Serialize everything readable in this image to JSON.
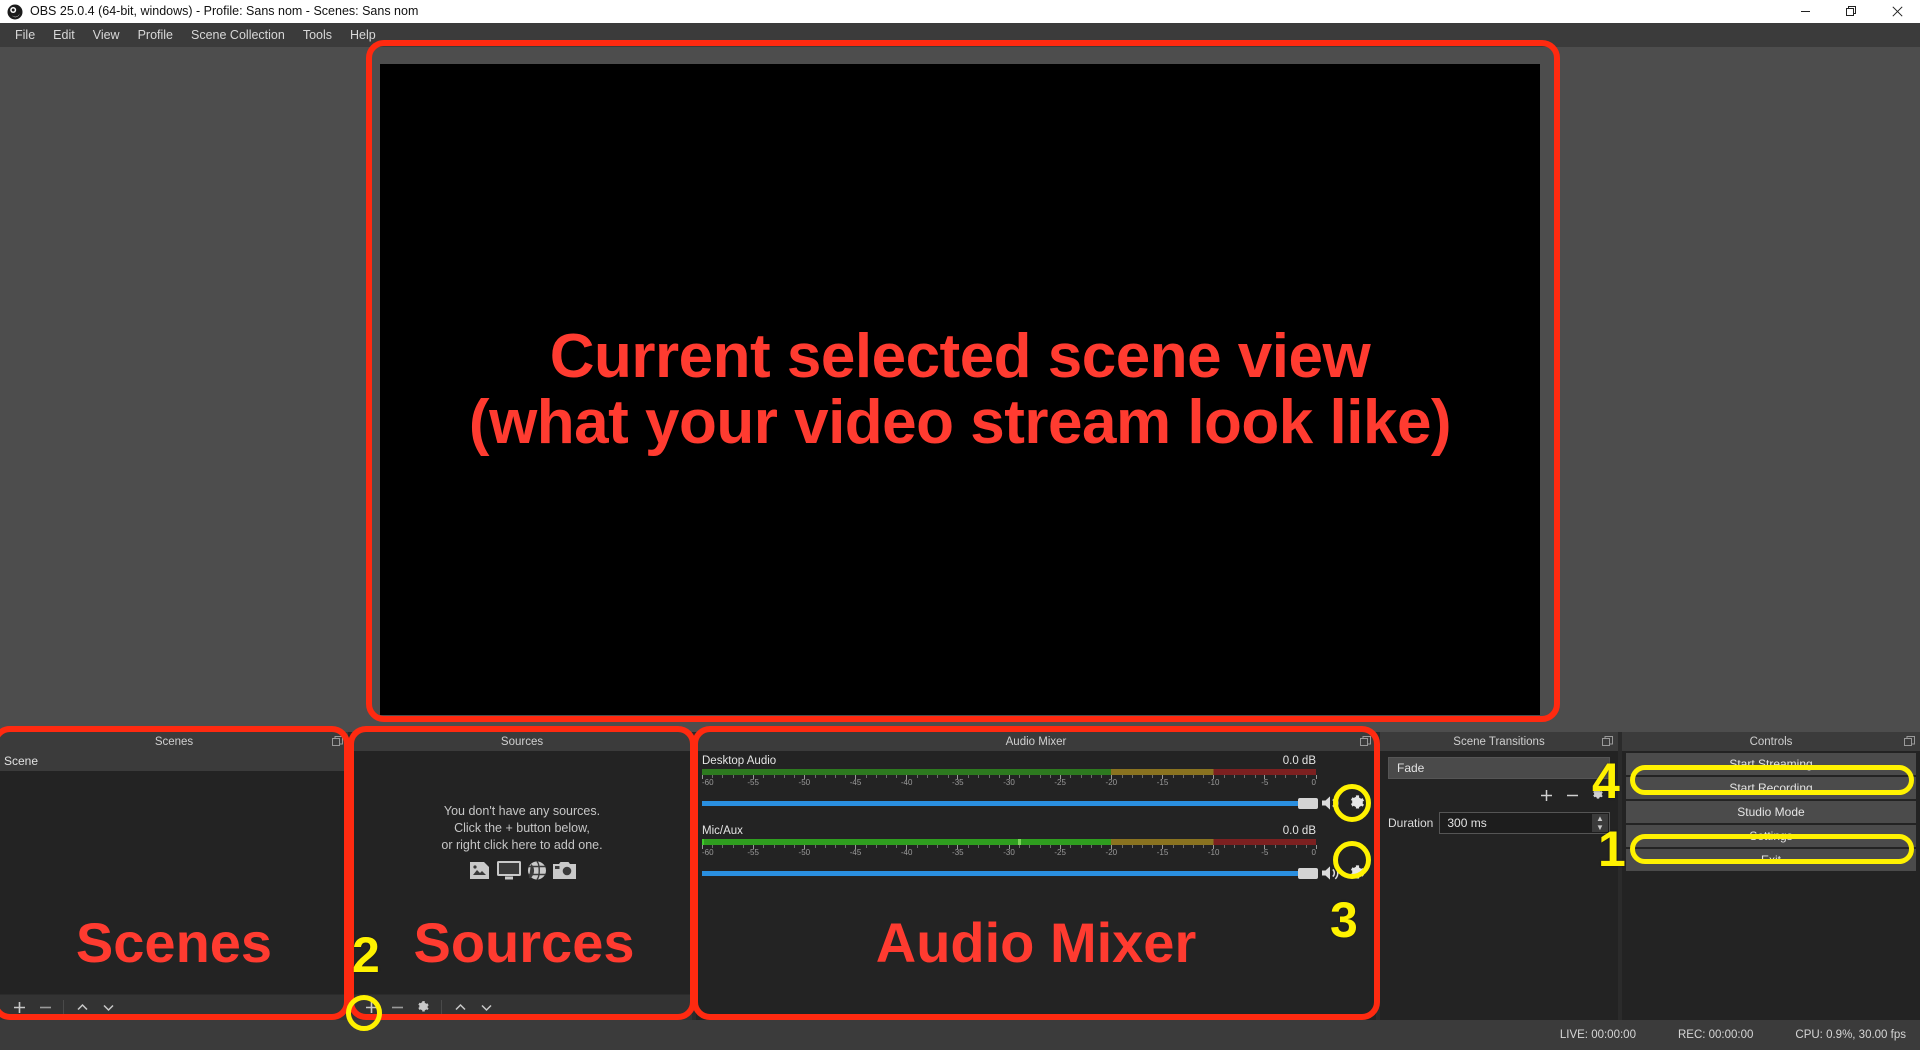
{
  "window": {
    "title": "OBS 25.0.4 (64-bit, windows) - Profile: Sans nom - Scenes: Sans nom",
    "app_icon": "obs-logo-icon",
    "minimize_label": "–",
    "maximize_label": "❐",
    "close_label": "✕"
  },
  "menubar": {
    "items": [
      {
        "label": "File"
      },
      {
        "label": "Edit"
      },
      {
        "label": "View"
      },
      {
        "label": "Profile"
      },
      {
        "label": "Scene Collection"
      },
      {
        "label": "Tools"
      },
      {
        "label": "Help"
      }
    ]
  },
  "preview": {
    "overlay_line1": "Current selected scene view",
    "overlay_line2": "(what your video stream look like)",
    "canvas_color": "#000000"
  },
  "scenes_dock": {
    "title": "Scenes",
    "items": [
      {
        "label": "Scene",
        "selected": true
      }
    ],
    "toolbar": {
      "add": "+",
      "remove": "−",
      "move_up": "⌃",
      "move_down": "⌄"
    },
    "annotation_label": "Scenes"
  },
  "sources_dock": {
    "title": "Sources",
    "empty_line1": "You don't have any sources.",
    "empty_line2": "Click the + button below,",
    "empty_line3": "or right click here to add one.",
    "empty_icons": [
      "image-source-icon",
      "display-capture-icon",
      "browser-source-icon",
      "camera-source-icon"
    ],
    "toolbar": {
      "add": "+",
      "remove": "−",
      "properties": "gear-icon",
      "move_up": "⌃",
      "move_down": "⌄"
    },
    "annotation_label": "Sources",
    "annotation_number": "2"
  },
  "mixer_dock": {
    "title": "Audio Mixer",
    "annotation_label": "Audio Mixer",
    "annotation_number": "3",
    "scale_ticks": [
      "-60",
      "-55",
      "-50",
      "-45",
      "-40",
      "-35",
      "-30",
      "-25",
      "-20",
      "-15",
      "-10",
      "-5",
      "0"
    ],
    "tracks": [
      {
        "name": "Desktop Audio",
        "db": "0.0 dB",
        "level_percent": 0,
        "peak_percent": null,
        "volume_percent": 100,
        "mute_icon": "speaker-on-icon",
        "settings_icon": "gear-icon"
      },
      {
        "name": "Mic/Aux",
        "db": "0.0 dB",
        "level_percent": 66.6,
        "peak_percent": 51.5,
        "volume_percent": 100,
        "mute_icon": "speaker-on-icon",
        "settings_icon": "gear-icon"
      }
    ]
  },
  "transitions_dock": {
    "title": "Scene Transitions",
    "transition_value": "Fade",
    "add_label": "+",
    "remove_label": "−",
    "properties_icon": "gear-icon",
    "duration_label": "Duration",
    "duration_value": "300 ms",
    "annotation_number": "4"
  },
  "controls_dock": {
    "title": "Controls",
    "buttons": [
      {
        "label": "Start Streaming",
        "highlighted": true
      },
      {
        "label": "Start Recording",
        "highlighted": false
      },
      {
        "label": "Studio Mode",
        "highlighted": false
      },
      {
        "label": "Settings",
        "highlighted": true
      },
      {
        "label": "Exit",
        "highlighted": false
      }
    ],
    "annotation_number": "1"
  },
  "statusbar": {
    "live": "LIVE: 00:00:00",
    "rec": "REC: 00:00:00",
    "cpu": "CPU: 0.9%, 30.00 fps"
  },
  "colors": {
    "annotation_red": "#ff2a10",
    "annotation_red_text": "#ff3b30",
    "annotation_yellow": "#fff200",
    "panel_bg": "#232323",
    "panel_header": "#3b3b3b",
    "app_bg": "#2b2b2b",
    "meter_green": "#2f9e1f",
    "meter_yellow": "#8a7320",
    "meter_red": "#7c2020",
    "slider_blue": "#2a8fe0"
  }
}
